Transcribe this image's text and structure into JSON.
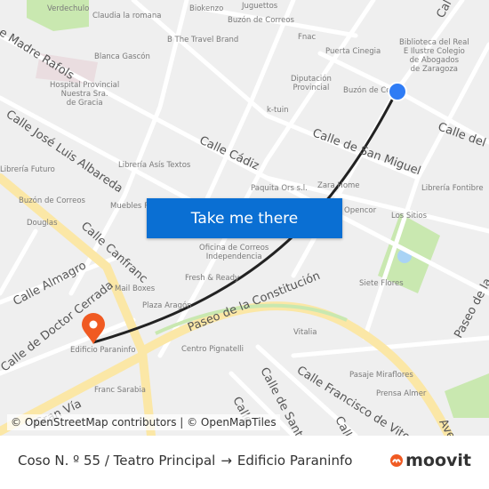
{
  "map": {
    "cta_label": "Take me there",
    "attribution": "© OpenStreetMap contributors | © OpenMapTiles",
    "colors": {
      "route": "#222222",
      "origin": "#2f7cf5",
      "destination": "#f05a22",
      "cta": "#0a6fd3",
      "major_road": "#fbe7a6",
      "park": "#c9e8b0"
    },
    "streets": [
      "e Madre Rafols",
      "Calle José Luis Albareda",
      "Calle Cádiz",
      "Calle de San Miguel",
      "Calle del C",
      "Calle Canfranc",
      "Calle Almagro",
      "Calle de Doctor Cerrada",
      "Paseo de la Constitución",
      "Calle Francisco de Vito",
      "Calle de Santa Jo",
      "Calle",
      "Paseo de la",
      "Avenida",
      "Gran Vía",
      "Calle",
      "Cal"
    ],
    "pois": [
      "Verdechulo",
      "Claudia la romana",
      "Biokenzo",
      "Juguettos",
      "Buzón de Correos",
      "B The Travel Brand",
      "Fnac",
      "Puerta Cinegia",
      "Blanca Gascón",
      "Hospital Provincial\nNuestra Sra.\nde Gracia",
      "Diputación\nProvincial",
      "Biblioteca del Real\nE Ilustre Colegio\nde Abogados\nde Zaragoza",
      "Buzón de Co",
      "k-tuin",
      "Librería Asís Textos",
      "Librería Futuro",
      "Paquita Ors s.l.",
      "Zara Home",
      "Librería Fontibre",
      "Buzón de Correos",
      "Muebles R",
      "Opencor",
      "Los Sitios",
      "Douglas",
      "Oficina de Correos\nIndependencia",
      "Fresh & Ready",
      "Mail Boxes",
      "Siete Flores",
      "Plaza Aragón",
      "Vitalia",
      "Edificio Paraninfo",
      "Centro Pignatelli",
      "Pasaje Miraflores",
      "Franc Sarabia",
      "Prensa Almer"
    ]
  },
  "footer": {
    "origin": "Coso N. º 55 / Teatro Principal",
    "arrow": "→",
    "destination": "Edificio Paraninfo",
    "brand": "moovit"
  }
}
